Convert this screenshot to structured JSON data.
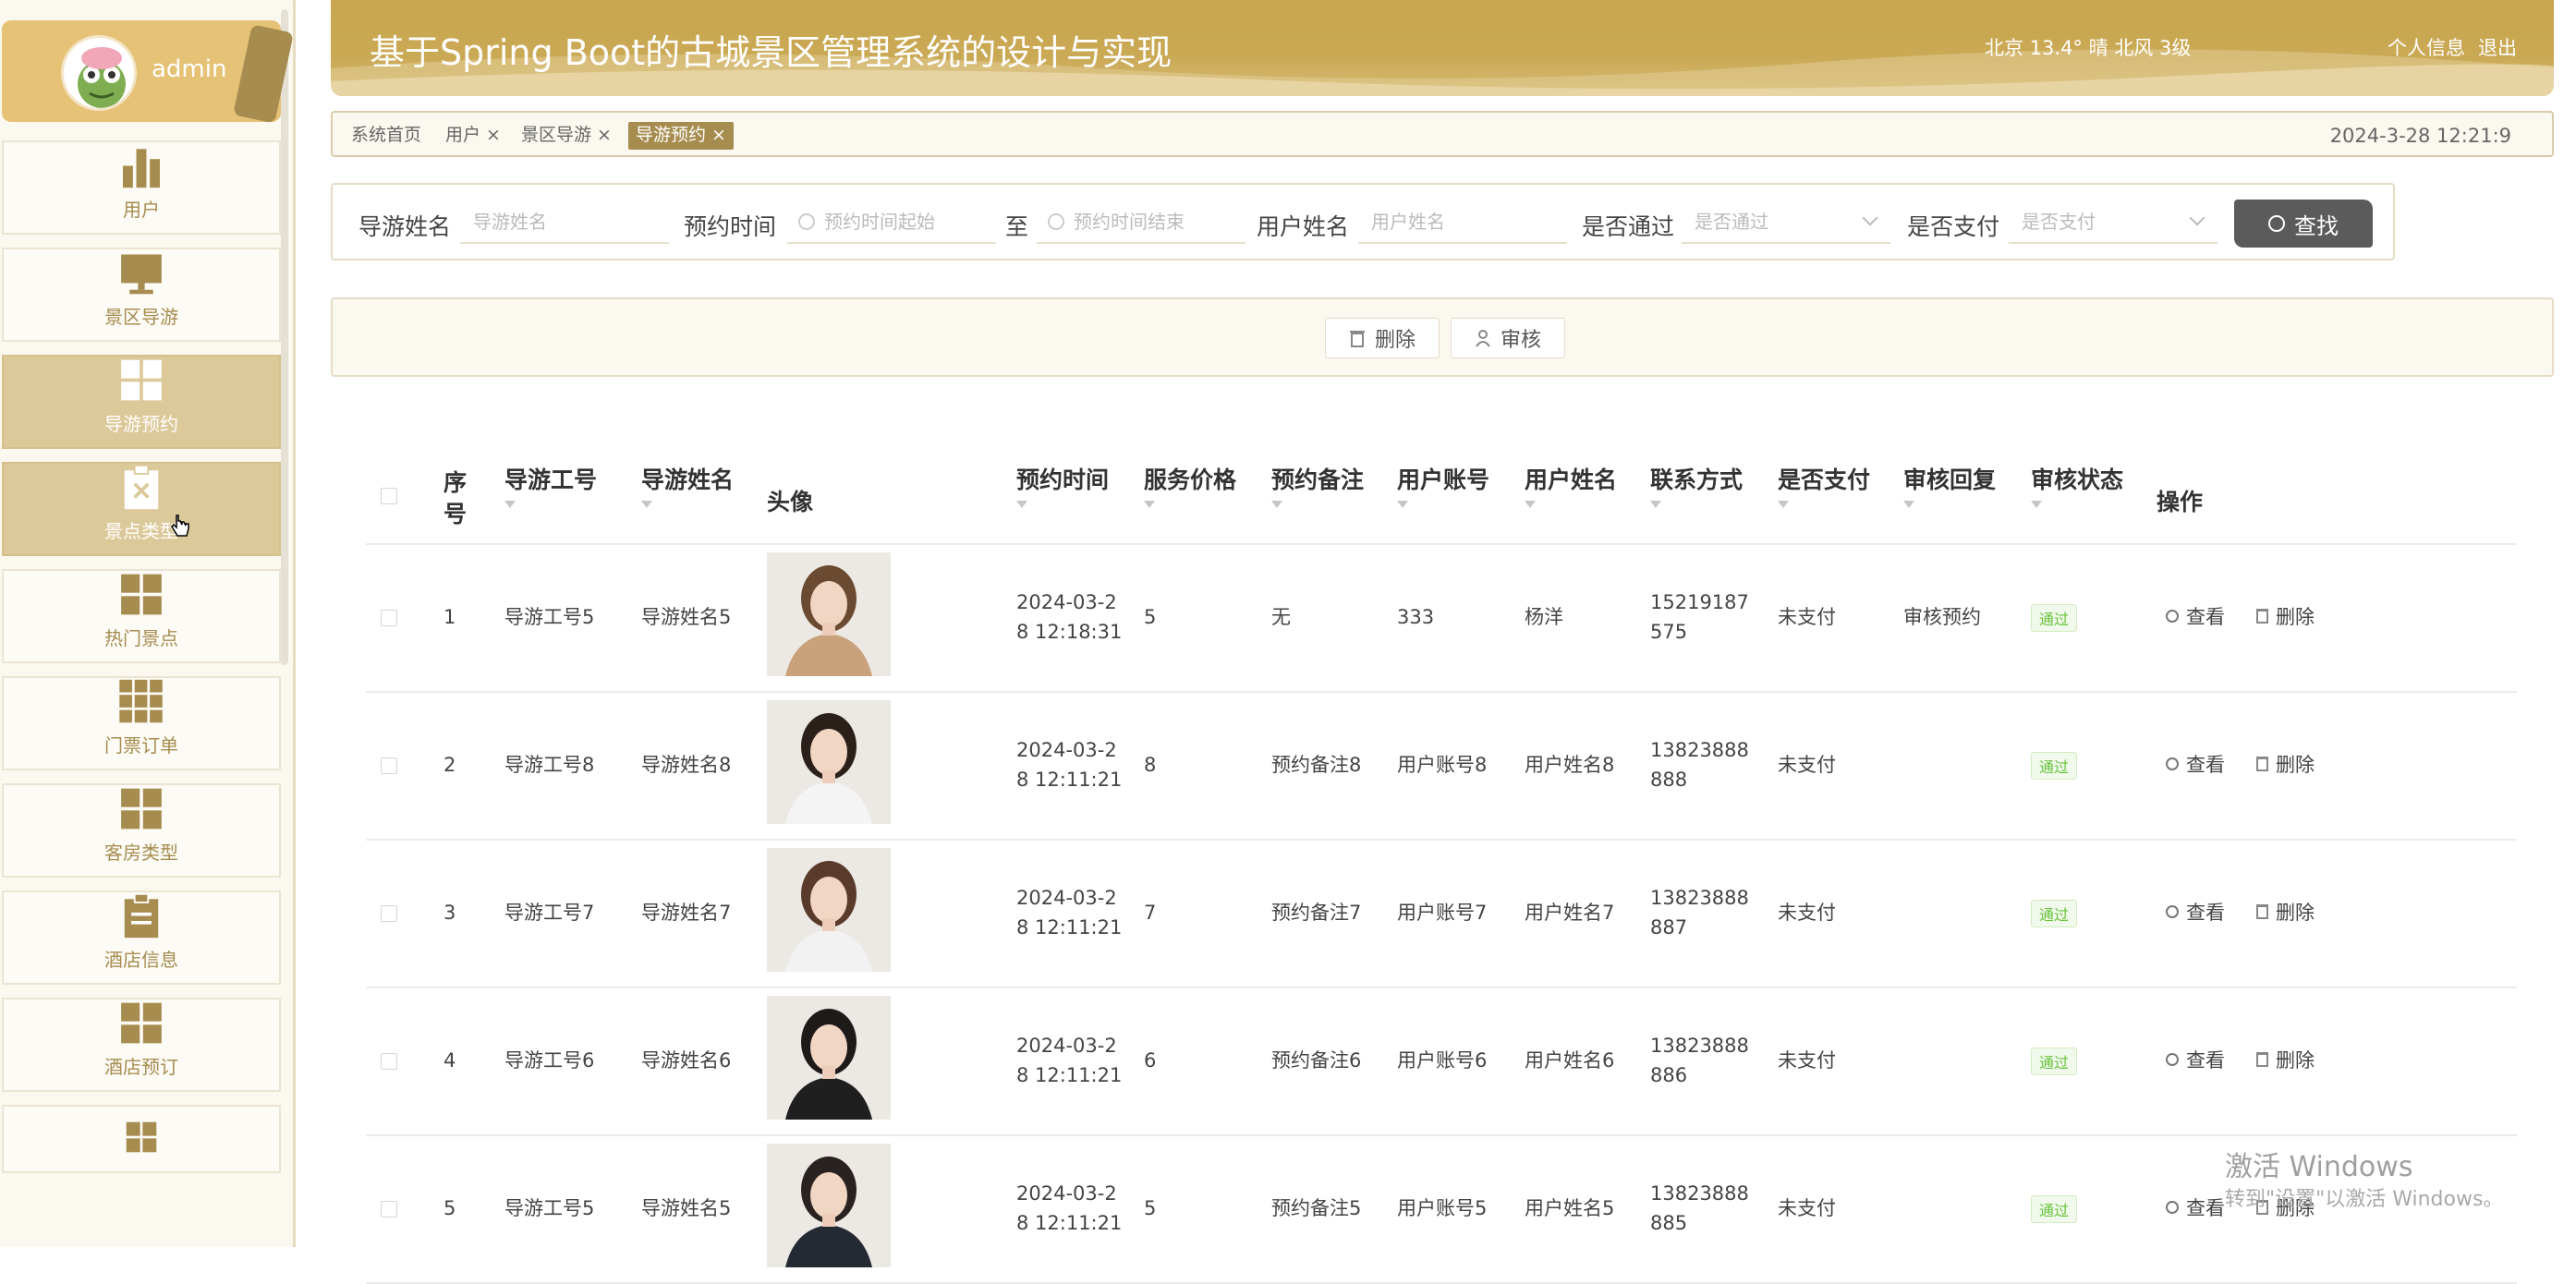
{
  "sidebar": {
    "username": "admin",
    "items": [
      {
        "label": "用户",
        "icon": "bar-chart-icon"
      },
      {
        "label": "景区导游",
        "icon": "monitor-icon"
      },
      {
        "label": "导游预约",
        "icon": "grid-icon"
      },
      {
        "label": "景点类型",
        "icon": "clipboard-x-icon"
      },
      {
        "label": "热门景点",
        "icon": "grid-icon"
      },
      {
        "label": "门票订单",
        "icon": "grid-nine-icon"
      },
      {
        "label": "客房类型",
        "icon": "grid-icon"
      },
      {
        "label": "酒店信息",
        "icon": "clipboard-icon"
      },
      {
        "label": "酒店预订",
        "icon": "grid-icon"
      },
      {
        "label": "",
        "icon": "grid-icon"
      }
    ]
  },
  "header": {
    "title": "基于Spring Boot的古城景区管理系统的设计与实现",
    "weather": "北京  13.4°  晴  北风  3级",
    "profile_link": "个人信息",
    "logout_link": "退出"
  },
  "tabs": {
    "items": [
      "系统首页",
      "用户 ×",
      "景区导游 ×",
      "导游预约 ×"
    ],
    "datetime": "2024-3-28 12:21:9"
  },
  "search": {
    "guide_name_label": "导游姓名",
    "guide_name_placeholder": "导游姓名",
    "time_label": "预约时间",
    "time_start_placeholder": "预约时间起始",
    "to_label": "至",
    "time_end_placeholder": "预约时间结束",
    "user_name_label": "用户姓名",
    "user_name_placeholder": "用户姓名",
    "passed_label": "是否通过",
    "passed_placeholder": "是否通过",
    "paid_label": "是否支付",
    "paid_placeholder": "是否支付",
    "search_button": "查找"
  },
  "actions": {
    "delete": "删除",
    "review": "审核"
  },
  "table": {
    "headers": {
      "index_1": "序",
      "index_2": "号",
      "guide_no": "导游工号",
      "guide_name": "导游姓名",
      "avatar": "头像",
      "time": "预约时间",
      "price": "服务价格",
      "note": "预约备注",
      "account": "用户账号",
      "user_name": "用户姓名",
      "contact": "联系方式",
      "paid": "是否支付",
      "reply": "审核回复",
      "status": "审核状态",
      "ops": "操作"
    },
    "rows": [
      {
        "index": "1",
        "guide_no": "导游工号5",
        "guide_name": "导游姓名5",
        "time_1": "2024-03-2",
        "time_2": "8 12:18:31",
        "price": "5",
        "note": "无",
        "account": "333",
        "user_name": "杨洋",
        "contact_1": "15219187",
        "contact_2": "575",
        "paid": "未支付",
        "reply": "审核预约",
        "status": "通过",
        "view": "查看",
        "delete": "删除"
      },
      {
        "index": "2",
        "guide_no": "导游工号8",
        "guide_name": "导游姓名8",
        "time_1": "2024-03-2",
        "time_2": "8 12:11:21",
        "price": "8",
        "note": "预约备注8",
        "account": "用户账号8",
        "user_name": "用户姓名8",
        "contact_1": "13823888",
        "contact_2": "888",
        "paid": "未支付",
        "reply": "",
        "status": "通过",
        "view": "查看",
        "delete": "删除"
      },
      {
        "index": "3",
        "guide_no": "导游工号7",
        "guide_name": "导游姓名7",
        "time_1": "2024-03-2",
        "time_2": "8 12:11:21",
        "price": "7",
        "note": "预约备注7",
        "account": "用户账号7",
        "user_name": "用户姓名7",
        "contact_1": "13823888",
        "contact_2": "887",
        "paid": "未支付",
        "reply": "",
        "status": "通过",
        "view": "查看",
        "delete": "删除"
      },
      {
        "index": "4",
        "guide_no": "导游工号6",
        "guide_name": "导游姓名6",
        "time_1": "2024-03-2",
        "time_2": "8 12:11:21",
        "price": "6",
        "note": "预约备注6",
        "account": "用户账号6",
        "user_name": "用户姓名6",
        "contact_1": "13823888",
        "contact_2": "886",
        "paid": "未支付",
        "reply": "",
        "status": "通过",
        "view": "查看",
        "delete": "删除"
      },
      {
        "index": "5",
        "guide_no": "导游工号5",
        "guide_name": "导游姓名5",
        "time_1": "2024-03-2",
        "time_2": "8 12:11:21",
        "price": "5",
        "note": "预约备注5",
        "account": "用户账号5",
        "user_name": "用户姓名5",
        "contact_1": "13823888",
        "contact_2": "885",
        "paid": "未支付",
        "reply": "",
        "status": "通过",
        "view": "查看",
        "delete": "删除"
      }
    ]
  },
  "watermark": {
    "line1": "激活 Windows",
    "line2": "转到\"设置\"以激活 Windows。"
  },
  "colors": {
    "accent": "#a68c4f",
    "header": "#c8a54e",
    "sidebar_active": "#dcc99a",
    "badge_green": "#67c23a"
  }
}
